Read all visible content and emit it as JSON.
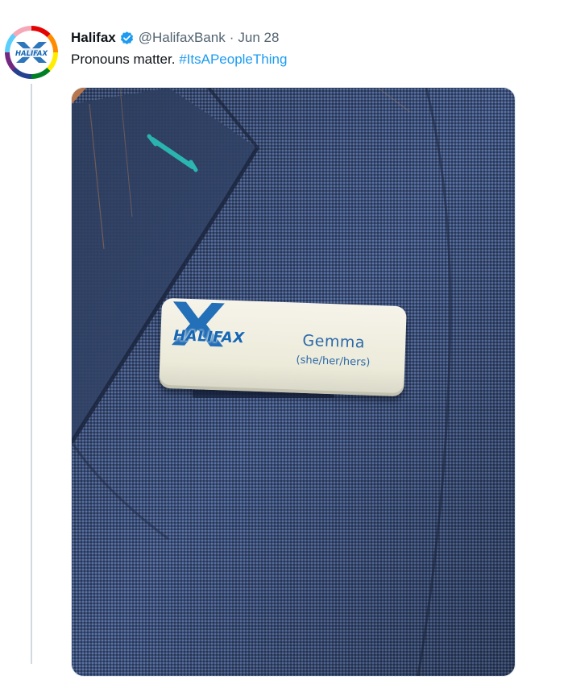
{
  "tweet": {
    "display_name": "Halifax",
    "handle": "@HalifaxBank",
    "separator": "·",
    "date": "Jun 28",
    "text": "Pronouns matter.",
    "hashtag": "#ItsAPeopleThing",
    "verified": true,
    "avatar": {
      "logo_text": "HALIFAX",
      "icon": "halifax-x-logo"
    }
  },
  "media": {
    "name_badge": {
      "logo_text": "HALIFAX",
      "name": "Gemma",
      "pronouns": "(she/her/hers)"
    }
  },
  "colors": {
    "link": "#1d9bf0",
    "secondary_text": "#536471",
    "primary_text": "#0f1419",
    "verified": "#1d9bf0",
    "brand_blue": "#1767b5",
    "jacket": "#3a4d75",
    "buttonhole_thread": "#2fc9c3"
  }
}
